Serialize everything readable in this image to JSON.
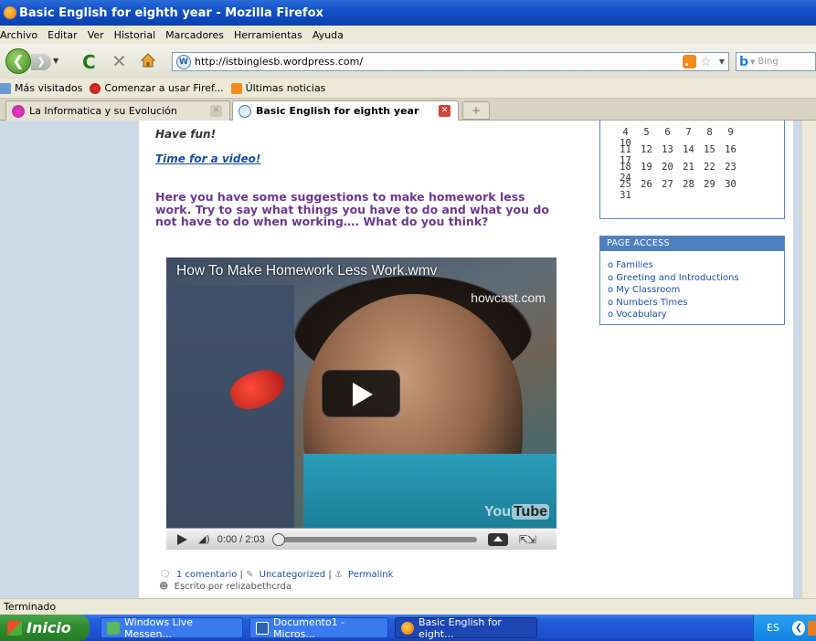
{
  "window": {
    "title": "Basic English for eighth year - Mozilla Firefox"
  },
  "menu": [
    "Archivo",
    "Editar",
    "Ver",
    "Historial",
    "Marcadores",
    "Herramientas",
    "Ayuda"
  ],
  "nav": {
    "url": "http://istbinglesb.wordpress.com/",
    "search_placeholder": "Bing"
  },
  "bookmarks": [
    "Más visitados",
    "Comenzar a usar Firef...",
    "Últimas noticias"
  ],
  "tabs": [
    {
      "label": "La Informatica y su Evolución",
      "active": false
    },
    {
      "label": "Basic English for eighth year",
      "active": true
    }
  ],
  "post": {
    "have_fun": "Have fun!",
    "video_link": "Time for a video!",
    "paragraph": "Here you have some suggestions to make homework less work. Try to say what things you have to do and what you  do not have to do when working…. What do you think?",
    "video": {
      "title": "How To Make Homework Less Work.wmv",
      "watermark": "howcast.com",
      "logo_you": "You",
      "logo_tube": "Tube",
      "time": "0:00 / 2:03",
      "progress": 0
    },
    "meta": {
      "comments": "1 comentario",
      "category": "Uncategorized",
      "permalink": "Permalink",
      "author": "Escrito por relizabethcrda",
      "sep": "|"
    }
  },
  "calendar": {
    "rows": [
      [
        "4",
        "5",
        "6",
        "7",
        "8",
        "9",
        "10"
      ],
      [
        "11",
        "12",
        "13",
        "14",
        "15",
        "16",
        "17"
      ],
      [
        "18",
        "19",
        "20",
        "21",
        "22",
        "23",
        "24"
      ],
      [
        "25",
        "26",
        "27",
        "28",
        "29",
        "30",
        "31"
      ]
    ]
  },
  "page_access": {
    "heading": "PAGE ACCESS",
    "items": [
      "Families",
      "Greeting and Introductions",
      "My Classroom",
      "Numbers Times",
      "Vocabulary"
    ]
  },
  "status": "Terminado",
  "taskbar": {
    "start": "Inicio",
    "tasks": [
      "Windows Live Messen...",
      "Documento1 - Micros...",
      "Basic English for eight..."
    ],
    "lang": "ES"
  },
  "colors": {
    "titlebar": "#0a3fb0",
    "link": "#1b4fa2",
    "post_heading": "#6b3a8e",
    "sidebar_header": "#4e7fc0"
  }
}
